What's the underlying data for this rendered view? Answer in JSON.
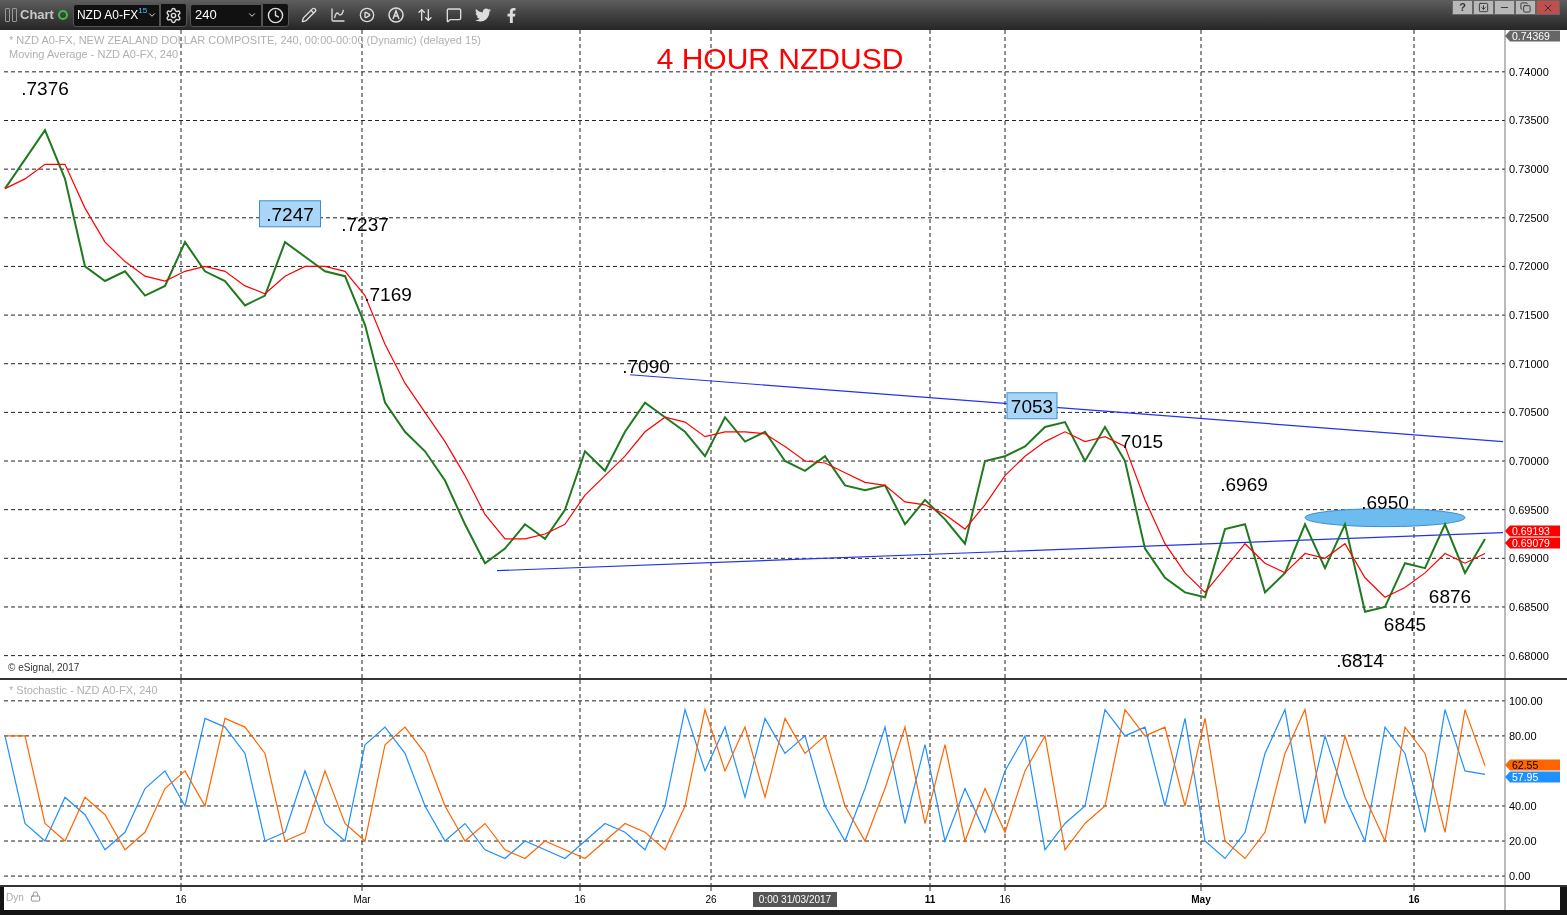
{
  "toolbar": {
    "title": "Chart",
    "connected": true,
    "symbol": "NZD A0-FX",
    "symbol_superscript": "15",
    "interval": "240",
    "help_label": "?"
  },
  "price_pane": {
    "legend_lines": [
      "* NZD A0-FX, NEW ZEALAND DOLLAR COMPOSITE, 240, 00:00-00:00 (Dynamic) (delayed 15)",
      "Moving Average - NZD A0-FX, 240"
    ],
    "title": "4 HOUR NZDUSD",
    "copyright": "© eSignal, 2017",
    "labels": [
      {
        "text": ".7376",
        "highlighted": false
      },
      {
        "text": ".7247",
        "highlighted": true
      },
      {
        "text": ".7237",
        "highlighted": false
      },
      {
        "text": ".7169",
        "highlighted": false
      },
      {
        "text": ".7090",
        "highlighted": false
      },
      {
        "text": "7053",
        "highlighted": true
      },
      {
        "text": "7015",
        "highlighted": false
      },
      {
        "text": ".6969",
        "highlighted": false
      },
      {
        "text": ".6950",
        "highlighted": false
      },
      {
        "text": "6876",
        "highlighted": false
      },
      {
        "text": "6845",
        "highlighted": false
      },
      {
        "text": ".6814",
        "highlighted": false
      }
    ],
    "flags": [
      {
        "text": "0.74369",
        "color": "#666666"
      },
      {
        "text": "0.69193",
        "color": "#ff0000"
      },
      {
        "text": "0.69079",
        "color": "#ff0000"
      }
    ],
    "chart_data": {
      "type": "line",
      "ylim": [
        0.6777,
        0.7443
      ],
      "grid": true,
      "yticks": [
        {
          "value": 0.74,
          "label": "0.74000"
        },
        {
          "value": 0.735,
          "label": "0.73500"
        },
        {
          "value": 0.73,
          "label": "0.73000"
        },
        {
          "value": 0.725,
          "label": "0.72500"
        },
        {
          "value": 0.72,
          "label": "0.72000"
        },
        {
          "value": 0.715,
          "label": "0.71500"
        },
        {
          "value": 0.71,
          "label": "0.71000"
        },
        {
          "value": 0.705,
          "label": "0.70500"
        },
        {
          "value": 0.7,
          "label": "0.70000"
        },
        {
          "value": 0.695,
          "label": "0.69500"
        },
        {
          "value": 0.69,
          "label": "0.69000"
        },
        {
          "value": 0.685,
          "label": "0.68500"
        },
        {
          "value": 0.68,
          "label": "0.68000"
        }
      ],
      "series": [
        {
          "color": "#1f7a1f",
          "values": [
            0.728,
            0.731,
            0.734,
            0.729,
            0.72,
            0.7185,
            0.7195,
            0.717,
            0.718,
            0.7225,
            0.7195,
            0.7185,
            0.716,
            0.717,
            0.7225,
            0.721,
            0.7195,
            0.719,
            0.714,
            0.706,
            0.703,
            0.701,
            0.698,
            0.6935,
            0.6895,
            0.691,
            0.6935,
            0.692,
            0.695,
            0.701,
            0.699,
            0.703,
            0.706,
            0.7045,
            0.703,
            0.7005,
            0.7045,
            0.702,
            0.703,
            0.7,
            0.699,
            0.7005,
            0.6975,
            0.697,
            0.6975,
            0.6935,
            0.696,
            0.694,
            0.6915,
            0.7,
            0.7005,
            0.7015,
            0.7035,
            0.704,
            0.7,
            0.7035,
            0.7,
            0.691,
            0.688,
            0.6865,
            0.686,
            0.693,
            0.6935,
            0.6865,
            0.6885,
            0.6935,
            0.689,
            0.6935,
            0.6845,
            0.685,
            0.6895,
            0.689,
            0.6935,
            0.6885,
            0.692
          ]
        },
        {
          "color": "#ff0000",
          "values": [
            0.728,
            0.729,
            0.7305,
            0.7305,
            0.726,
            0.7225,
            0.7205,
            0.719,
            0.7185,
            0.7195,
            0.72,
            0.7195,
            0.718,
            0.7172,
            0.719,
            0.72,
            0.72,
            0.7195,
            0.717,
            0.712,
            0.708,
            0.705,
            0.702,
            0.6985,
            0.6945,
            0.692,
            0.692,
            0.6925,
            0.6935,
            0.6965,
            0.6985,
            0.7005,
            0.703,
            0.7045,
            0.704,
            0.7025,
            0.703,
            0.703,
            0.7028,
            0.7015,
            0.7,
            0.6998,
            0.6988,
            0.6978,
            0.6975,
            0.6958,
            0.6955,
            0.6945,
            0.693,
            0.6955,
            0.6985,
            0.7005,
            0.702,
            0.703,
            0.702,
            0.7025,
            0.7015,
            0.696,
            0.6915,
            0.6885,
            0.6865,
            0.689,
            0.6915,
            0.6895,
            0.6885,
            0.6905,
            0.69,
            0.6915,
            0.688,
            0.686,
            0.687,
            0.6885,
            0.6905,
            0.6895,
            0.6905
          ]
        }
      ]
    }
  },
  "stochastic_pane": {
    "legend_lines": [
      "* Stochastic - NZD A0-FX, 240"
    ],
    "flags": [
      {
        "text": "62.55",
        "color": "#ff6600"
      },
      {
        "text": "57.95",
        "color": "#1e90ff"
      }
    ],
    "chart_data": {
      "type": "line",
      "ylim": [
        -5.1,
        111.9
      ],
      "grid": true,
      "yticks": [
        {
          "value": 100,
          "label": "100.00"
        },
        {
          "value": 80,
          "label": "80.00"
        },
        {
          "value": 40,
          "label": "40.00"
        },
        {
          "value": 20,
          "label": "20.00"
        },
        {
          "value": 0,
          "label": "0.00"
        }
      ],
      "series": [
        {
          "color": "#1e90ff",
          "values": [
            80,
            30,
            20,
            45,
            35,
            15,
            25,
            50,
            60,
            40,
            90,
            85,
            70,
            20,
            25,
            60,
            30,
            20,
            75,
            85,
            70,
            40,
            20,
            30,
            15,
            10,
            20,
            15,
            10,
            20,
            30,
            25,
            15,
            40,
            95,
            60,
            85,
            45,
            90,
            70,
            80,
            40,
            20,
            50,
            85,
            30,
            75,
            20,
            50,
            25,
            60,
            80,
            15,
            30,
            40,
            95,
            80,
            85,
            40,
            90,
            20,
            10,
            25,
            70,
            95,
            30,
            80,
            45,
            20,
            85,
            70,
            25,
            95,
            60,
            58
          ]
        },
        {
          "color": "#ff6600",
          "values": [
            80,
            80,
            30,
            20,
            45,
            35,
            15,
            25,
            50,
            60,
            40,
            90,
            85,
            70,
            20,
            25,
            60,
            30,
            20,
            75,
            85,
            70,
            40,
            20,
            30,
            15,
            10,
            20,
            15,
            10,
            20,
            30,
            25,
            15,
            40,
            95,
            60,
            85,
            45,
            90,
            70,
            80,
            40,
            20,
            50,
            85,
            30,
            75,
            20,
            50,
            25,
            60,
            80,
            15,
            30,
            40,
            95,
            80,
            85,
            40,
            90,
            20,
            10,
            25,
            70,
            95,
            30,
            80,
            45,
            20,
            85,
            70,
            25,
            95,
            63
          ]
        }
      ]
    }
  },
  "time_axis": {
    "mode_label": "Dyn",
    "cursor_label": "0:00 31/03/2017",
    "labels": [
      {
        "text": "16",
        "bold": false
      },
      {
        "text": "Mar",
        "bold": false
      },
      {
        "text": "16",
        "bold": false
      },
      {
        "text": "26",
        "bold": false
      },
      {
        "text": "11",
        "bold": true
      },
      {
        "text": "16",
        "bold": false
      },
      {
        "text": "May",
        "bold": true
      },
      {
        "text": "16",
        "bold": true
      }
    ]
  }
}
